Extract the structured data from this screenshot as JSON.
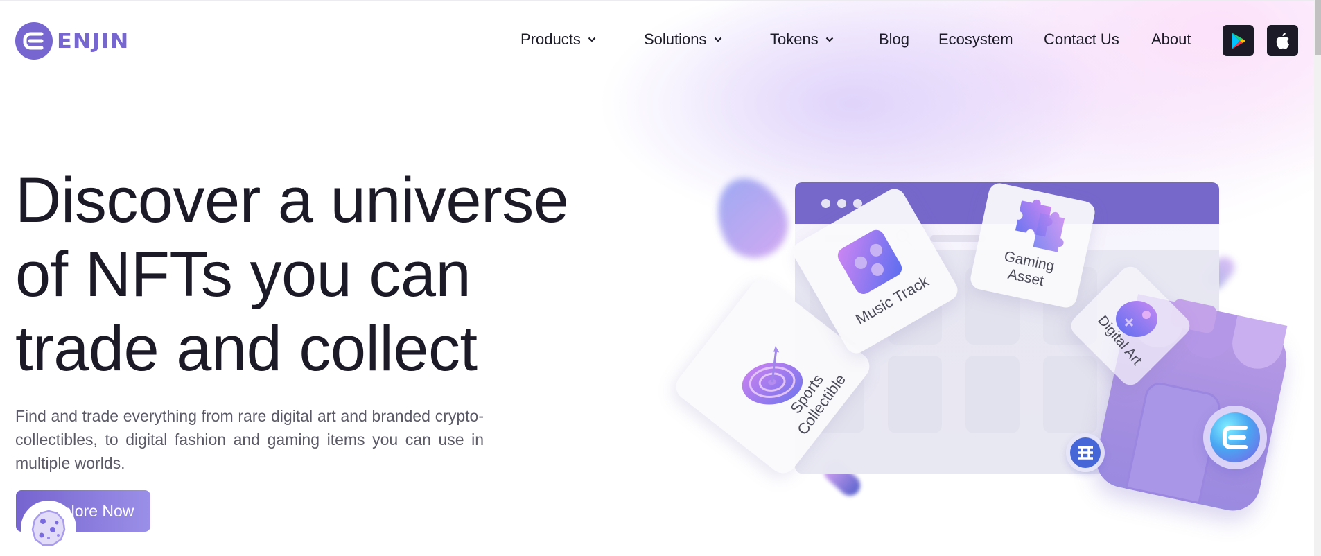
{
  "brand": {
    "name": "ENJIN",
    "accent_color": "#7866d0"
  },
  "nav": {
    "items": [
      {
        "label": "Products",
        "has_dropdown": true
      },
      {
        "label": "Solutions",
        "has_dropdown": true
      },
      {
        "label": "Tokens",
        "has_dropdown": true
      },
      {
        "label": "Blog",
        "has_dropdown": false
      },
      {
        "label": "Ecosystem",
        "has_dropdown": false
      },
      {
        "label": "Contact Us",
        "has_dropdown": false
      },
      {
        "label": "About",
        "has_dropdown": false
      }
    ],
    "store_buttons": [
      {
        "icon": "google-play-icon",
        "label": "Google Play"
      },
      {
        "icon": "apple-icon",
        "label": "App Store"
      }
    ]
  },
  "hero": {
    "title_lines": [
      "Discover a universe",
      "of NFTs you can",
      "trade and collect"
    ],
    "description": "Find and trade everything from rare digital art and branded crypto-collectibles, to digital fashion and gaming items you can use in multiple worlds.",
    "cta_label": "Explore Now"
  },
  "illustration": {
    "cards": [
      {
        "label": "Music Track",
        "icon": "sliders-icon"
      },
      {
        "label": "Gaming Asset",
        "icon": "puzzle-icon"
      },
      {
        "label": "Digital Art",
        "icon": "palette-icon"
      },
      {
        "label": "Sports Collectible",
        "icon": "target-icon"
      }
    ],
    "colors": {
      "browser_bar": "#7668cb",
      "store": "#a48ee0"
    }
  },
  "cookie_badge": {
    "icon": "cookie-icon"
  }
}
